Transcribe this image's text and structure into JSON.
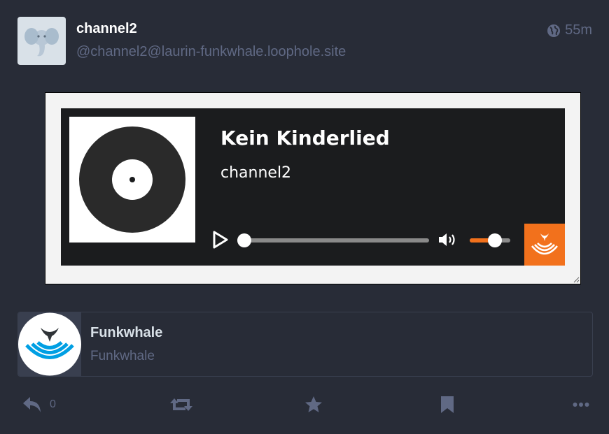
{
  "status": {
    "display_name": "channel2",
    "account": "@channel2@laurin-funkwhale.loophole.site",
    "relative_time": "55m",
    "visibility_icon": "globe-icon",
    "avatar_icon": "elephant-avatar"
  },
  "embed": {
    "player": {
      "title": "Kein Kinderlied",
      "artist": "channel2",
      "progress": 0.0,
      "volume": 0.62,
      "play_icon": "play-icon",
      "volume_icon": "volume-icon",
      "brand_icon": "funkwhale-logo",
      "accent_color": "#f2711c"
    }
  },
  "card": {
    "title": "Funkwhale",
    "description": "Funkwhale",
    "thumbnail_icon": "funkwhale-logo"
  },
  "actions": {
    "reply_count": "0",
    "reply_icon": "reply-icon",
    "boost_icon": "boost-icon",
    "favourite_icon": "star-icon",
    "bookmark_icon": "bookmark-icon",
    "more_icon": "ellipsis-icon"
  }
}
